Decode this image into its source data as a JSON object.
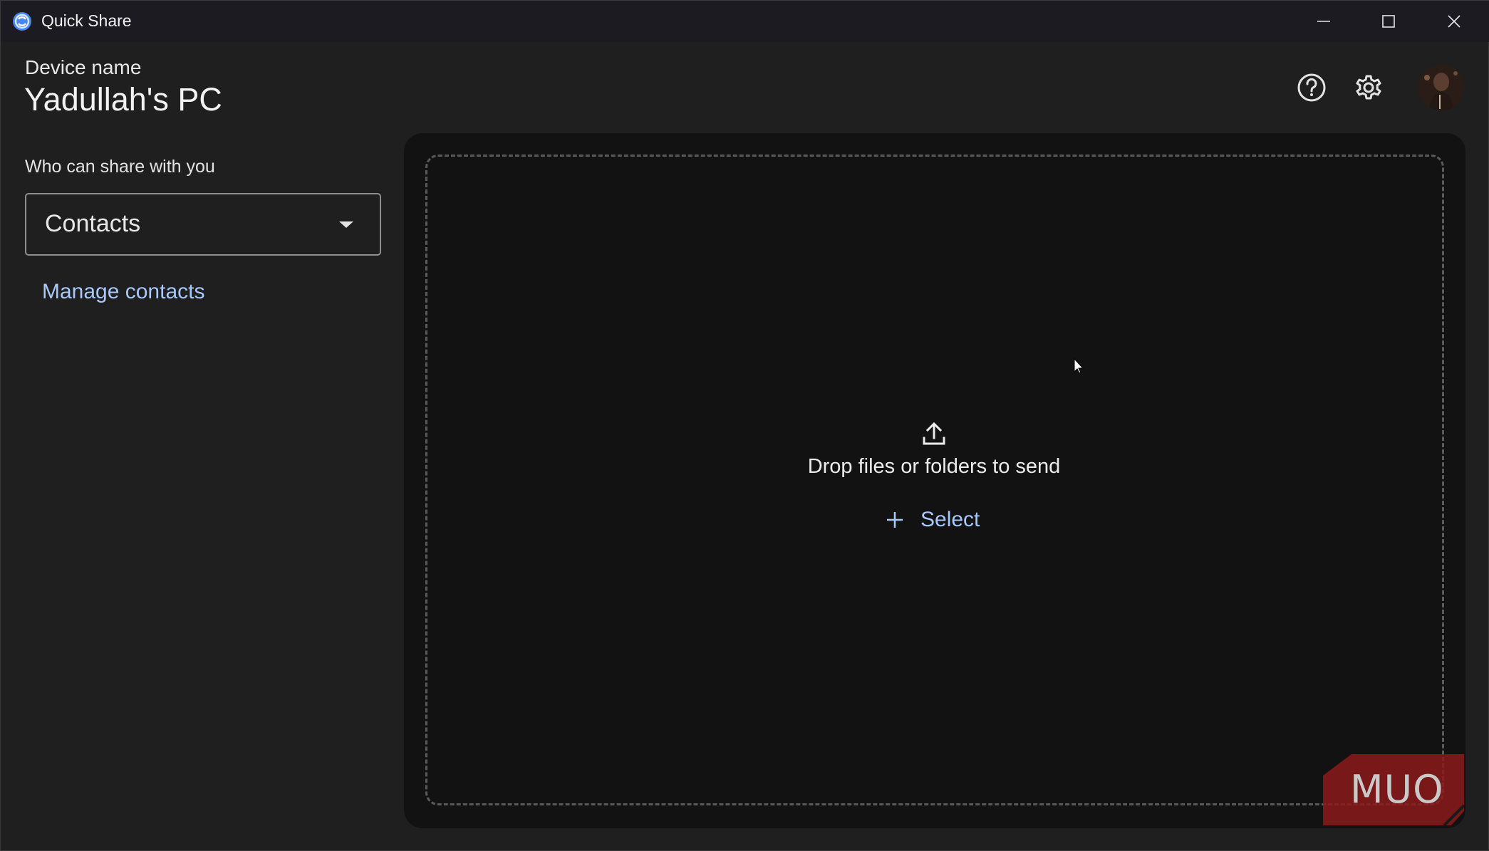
{
  "window": {
    "title": "Quick Share",
    "controls": {
      "minimize": "minimize",
      "maximize": "maximize",
      "close": "close"
    }
  },
  "header": {
    "device_label": "Device name",
    "device_name": "Yadullah's PC",
    "icons": [
      "help-icon",
      "settings-gear-icon",
      "profile-avatar"
    ]
  },
  "sidebar": {
    "visibility_label": "Who can share with you",
    "visibility_dropdown": {
      "selected": "Contacts"
    },
    "manage_link": "Manage contacts"
  },
  "dropzone": {
    "prompt": "Drop files or folders to send",
    "select_label": "Select"
  },
  "watermark": {
    "text": "MUO"
  },
  "colors": {
    "background": "#1f1f1f",
    "titlebar": "#1c1b22",
    "dropzone": "#121212",
    "accent_link": "#a8c7fa",
    "watermark_red": "#8b1a1a"
  }
}
